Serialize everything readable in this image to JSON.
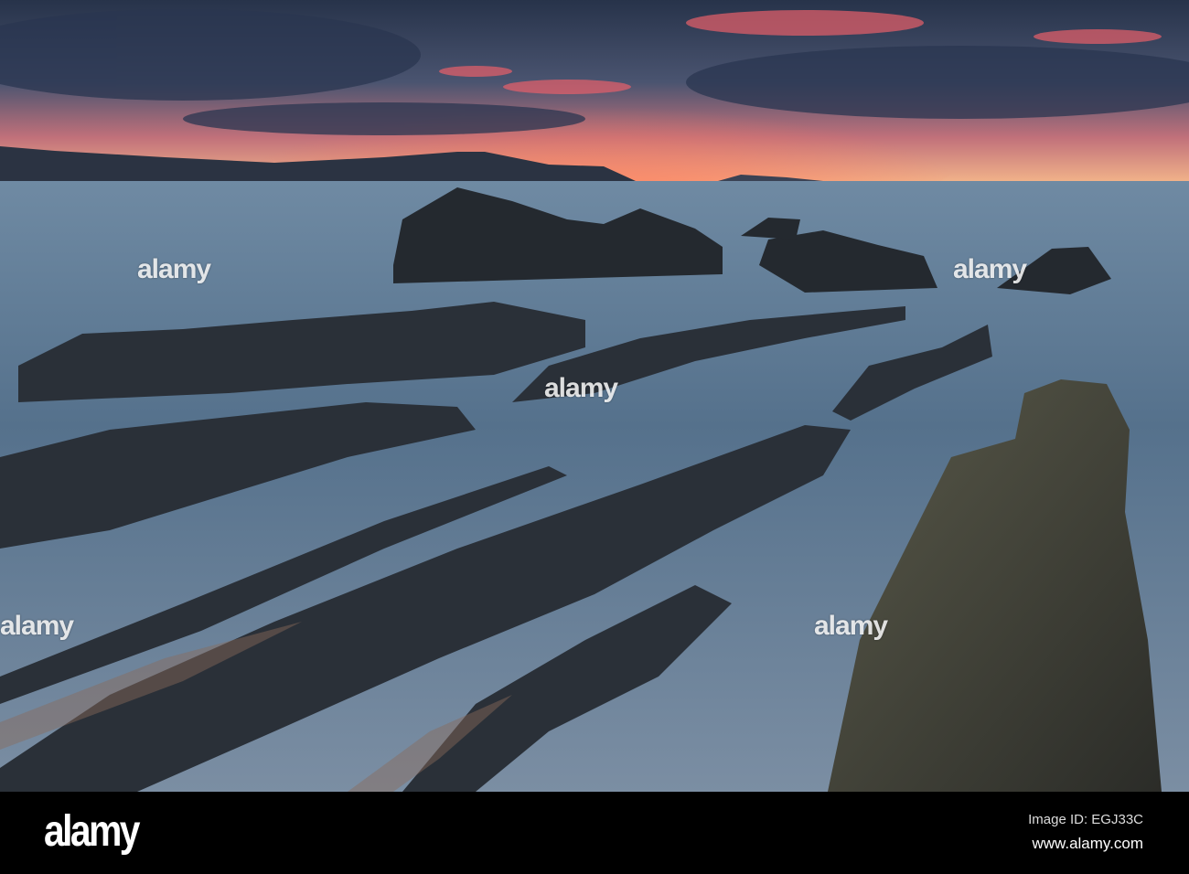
{
  "photo": {
    "subject": "rock-strata-seascape-sunset",
    "colors": {
      "sky_top": "#2b3a55",
      "sunset": "#f06a5a",
      "glow": "#f7b27a",
      "sea": "#5b7590",
      "rock": "#2a3036",
      "sand": "#8a6a5a"
    }
  },
  "watermark": {
    "text": "alamy"
  },
  "footer": {
    "logo": "alamy",
    "image_id": "Image ID: EGJ33C",
    "website": "www.alamy.com"
  }
}
